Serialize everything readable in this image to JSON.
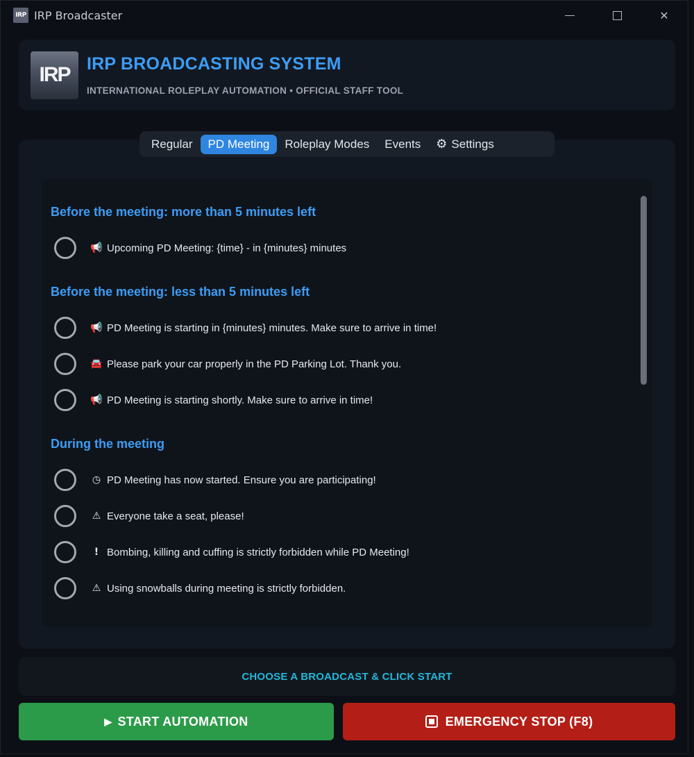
{
  "window": {
    "title": "IRP Broadcaster",
    "icon_text": "IRP"
  },
  "header": {
    "logo_text": "IRP",
    "title": "IRP BROADCASTING SYSTEM",
    "subtitle": "INTERNATIONAL ROLEPLAY AUTOMATION • OFFICIAL STAFF TOOL"
  },
  "tabs": [
    {
      "label": "Regular",
      "active": false
    },
    {
      "label": "PD Meeting",
      "active": true
    },
    {
      "label": "Roleplay Modes",
      "active": false
    },
    {
      "label": "Events",
      "active": false
    },
    {
      "label": "Settings",
      "active": false,
      "icon": "gear-icon"
    }
  ],
  "sections": [
    {
      "title": "Before the meeting: more than 5 minutes left",
      "items": [
        {
          "icon": "megaphone-icon",
          "glyph": "📢",
          "text": "Upcoming PD Meeting: {time} - in {minutes} minutes"
        }
      ]
    },
    {
      "title": "Before the meeting: less than 5 minutes left",
      "items": [
        {
          "icon": "megaphone-icon",
          "glyph": "📢",
          "text": "PD Meeting is starting in {minutes} minutes. Make sure to arrive in time!"
        },
        {
          "icon": "car-icon",
          "glyph": "🚘",
          "text": "Please park your car properly in the PD Parking Lot. Thank you."
        },
        {
          "icon": "megaphone-icon",
          "glyph": "📢",
          "text": "PD Meeting is starting shortly. Make sure to arrive in time!"
        }
      ]
    },
    {
      "title": "During the meeting",
      "items": [
        {
          "icon": "clock-icon",
          "glyph": "◷",
          "text": "PD Meeting has now started. Ensure you are participating!"
        },
        {
          "icon": "warning-icon",
          "glyph": "⚠",
          "text": "Everyone take a seat, please!"
        },
        {
          "icon": "exclamation-icon",
          "glyph": "!",
          "text": "Bombing, killing and cuffing is strictly forbidden while PD Meeting!"
        },
        {
          "icon": "warning-icon",
          "glyph": "⚠",
          "text": "Using snowballs during meeting is strictly forbidden."
        }
      ]
    }
  ],
  "status": {
    "text": "CHOOSE A BROADCAST & CLICK START"
  },
  "buttons": {
    "start": "START AUTOMATION",
    "stop": "EMERGENCY STOP (F8)"
  },
  "colors": {
    "accent": "#3d9df5",
    "tab_active": "#2f86e0",
    "status": "#23b7d8",
    "start": "#2b9b49",
    "stop": "#b31f16"
  }
}
